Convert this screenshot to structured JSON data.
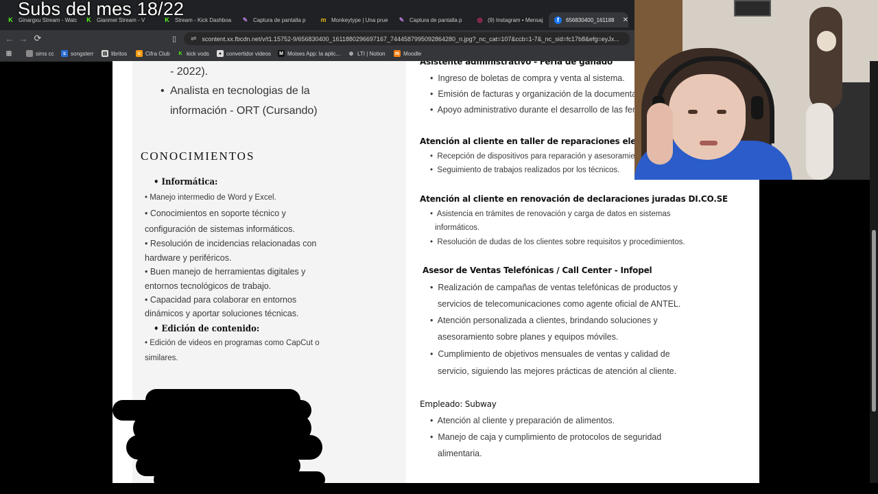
{
  "overlay": {
    "subs_text": "Subs del mes 18/22"
  },
  "browser": {
    "tabs": [
      {
        "label": "Ginargxu Stream - Watc",
        "icon": "kick-icon",
        "color": "#53fc18"
      },
      {
        "label": "Gianmei Stream - V",
        "icon": "kick-icon",
        "color": "#53fc18"
      },
      {
        "label": "Stream - Kick Dashboa",
        "icon": "kick-icon",
        "color": "#53fc18"
      },
      {
        "label": "Captura de pantalla p",
        "icon": "feather-icon",
        "color": "#b57edc"
      },
      {
        "label": "Monkeytype | Una prue",
        "icon": "monkeytype-icon",
        "color": "#e2b714"
      },
      {
        "label": "Captura de pantalla p",
        "icon": "feather-icon",
        "color": "#b57edc"
      },
      {
        "label": "(9) Instagram • Mensaj",
        "icon": "instagram-icon",
        "color": "#e1306c"
      },
      {
        "label": "656830400_161188",
        "icon": "facebook-icon",
        "color": "#1877f2"
      }
    ],
    "active_tab_index": 7,
    "url": "scontent.xx.fbcdn.net/v/t1.15752-9/656830400_1611880296697167_7444587995092864280_n.jpg?_nc_cat=107&ccb=1-7&_nc_sid=fc17b8&efg=eyJx...",
    "bookmarks": [
      {
        "label": "sims cc",
        "icon": "folder-icon",
        "color": "#8a8a8a"
      },
      {
        "label": "songsterr",
        "icon": "songsterr-icon",
        "color": "#2b6fd6"
      },
      {
        "label": "libritos",
        "icon": "book-icon",
        "color": "#ddd"
      },
      {
        "label": "Cifra Club",
        "icon": "cifraclub-icon",
        "color": "#f39c12"
      },
      {
        "label": "kick vods",
        "icon": "kick-icon",
        "color": "#53fc18"
      },
      {
        "label": "convertidor videos",
        "icon": "convert-icon",
        "color": "#ddd"
      },
      {
        "label": "Moises App: la aplic...",
        "icon": "moises-icon",
        "color": "#111"
      },
      {
        "label": "LTI | Notion",
        "icon": "globe-icon",
        "color": "#8a8a8a"
      },
      {
        "label": "Moodle",
        "icon": "moodle-icon",
        "color": "#f98012"
      }
    ]
  },
  "cv": {
    "left": {
      "edu_tail": "- 2022).",
      "edu_item_line1": "Analista en tecnologias de la",
      "edu_item_line2": "información - ORT (Cursando)",
      "skills_heading": "CONOCIMIENTOS",
      "it_heading": "Informática:",
      "it_lines": [
        "• Manejo intermedio de Word y Excel.",
        "• Conocimientos en soporte técnico y",
        "configuración de sistemas informáticos.",
        "• Resolución de incidencias relacionadas con",
        "hardware y periféricos.",
        "• Buen manejo de herramientas digitales y",
        "entornos tecnológicos de trabajo.",
        "• Capacidad para colaborar en entornos",
        "dinámicos y aportar soluciones técnicas."
      ],
      "content_heading": "Edición de contenido:",
      "content_lines": [
        "• Edición de videos en programas como CapCut o",
        "similares."
      ]
    },
    "right": {
      "job0_title": "Asistente administrativo - Feria de ganado",
      "job0_items": [
        "Ingreso de boletas de compra y venta al sistema.",
        "Emisión de facturas y organización de la documentación.",
        "Apoyo administrativo durante el desarrollo de las ferias."
      ],
      "job1_title": "Atención al cliente en taller de reparaciones electrónicas",
      "job1_items": [
        "Recepción de dispositivos para reparación y asesoramiento.",
        "Seguimiento de trabajos realizados por los técnicos."
      ],
      "job2_title": "Atención al cliente en renovación de declaraciones juradas DI.CO.SE",
      "job2_items": [
        "Asistencia en trámites de renovación y carga de datos en sistemas",
        "informáticos.",
        "Resolución de dudas de los clientes sobre requisitos y procedimientos."
      ],
      "job3_title": "Asesor de Ventas Telefónicas / Call Center - Infopel",
      "job3_items": [
        "Realización de campañas de ventas telefónicas de productos y",
        "servicios de telecomunicaciones como agente oficial de ANTEL.",
        "Atención personalizada a clientes, brindando soluciones y",
        "asesoramiento sobre planes y equipos móviles.",
        "Cumplimiento de objetivos mensuales de ventas y calidad de",
        "servicio, siguiendo las mejores prácticas de atención al cliente."
      ],
      "job4_title": "Empleado: Subway",
      "job4_items": [
        "Atención al cliente y preparación de alimentos.",
        "Manejo de caja y cumplimiento de protocolos de seguridad",
        "alimentaria."
      ]
    }
  }
}
